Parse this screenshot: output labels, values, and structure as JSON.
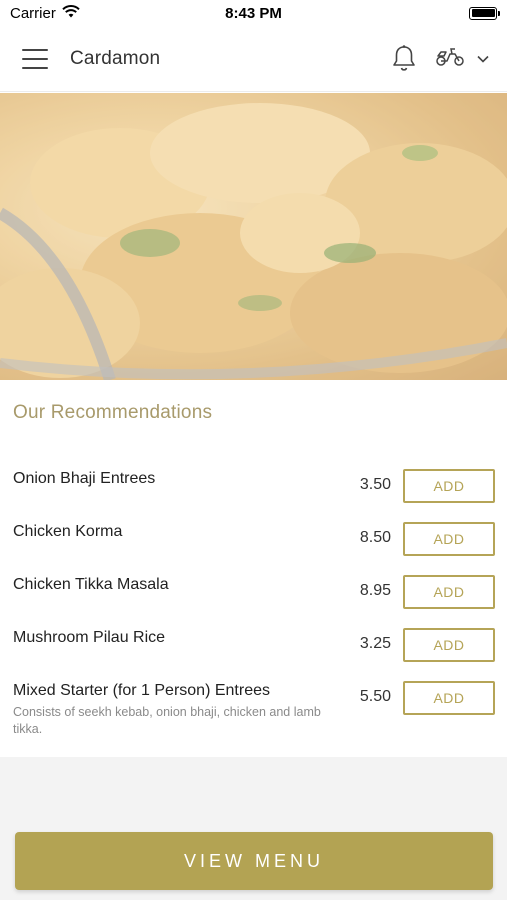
{
  "status_bar": {
    "carrier": "Carrier",
    "time": "8:43 PM"
  },
  "header": {
    "title": "Cardamon",
    "icons": [
      "menu-icon",
      "bell-icon",
      "scooter-icon",
      "chevron-down-icon"
    ]
  },
  "hero": {
    "image": "curry dish photo"
  },
  "recommendations": {
    "title": "Our Recommendations",
    "items": [
      {
        "name": "Onion Bhaji Entrees",
        "price": "3.50",
        "description": "",
        "add_label": "ADD"
      },
      {
        "name": "Chicken Korma",
        "price": "8.50",
        "description": "",
        "add_label": "ADD"
      },
      {
        "name": "Chicken Tikka Masala",
        "price": "8.95",
        "description": "",
        "add_label": "ADD"
      },
      {
        "name": "Mushroom Pilau Rice",
        "price": "3.25",
        "description": "",
        "add_label": "ADD"
      },
      {
        "name": "Mixed Starter (for 1 Person) Entrees",
        "price": "5.50",
        "description": "Consists of seekh kebab, onion bhaji, chicken and lamb tikka.",
        "add_label": "ADD"
      }
    ]
  },
  "footer": {
    "view_menu_label": "VIEW MENU"
  },
  "colors": {
    "accent": "#b3a353",
    "section_title": "#a89a6b"
  }
}
